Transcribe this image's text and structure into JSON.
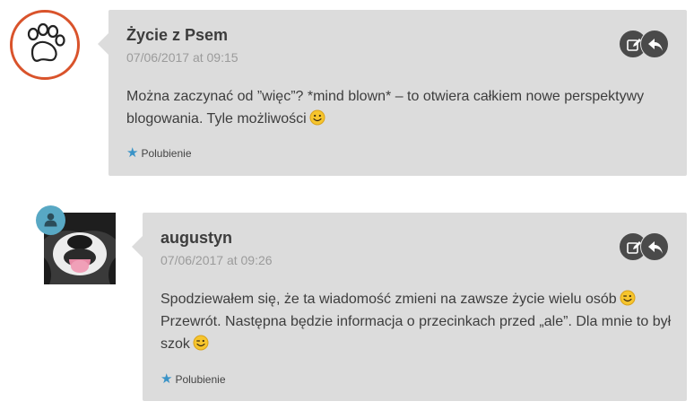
{
  "comments": [
    {
      "author": "Życie z Psem",
      "date": "07/06/2017 at 09:15",
      "text": "Można zaczynać od ”więc”? *mind blown* – to otwiera całkiem nowe perspektywy blogowania. Tyle możliwości",
      "emoji": "smile",
      "like_label": "Polubienie"
    },
    {
      "author": "augustyn",
      "date": "07/06/2017 at 09:26",
      "text_part1": "Spodziewałem się, że ta wiadomość zmieni na zawsze życie wielu osób",
      "emoji1": "wink",
      "text_part2": "Przewrót. Następna będzie informacja o przecinkach przed „ale”. Dla mnie to był szok",
      "emoji2": "wink",
      "like_label": "Polubienie"
    }
  ],
  "icons": {
    "paw_avatar": "paw-avatar",
    "user_badge": "user-icon",
    "edit": "edit-icon",
    "reply": "reply-icon",
    "star": "star-icon"
  },
  "colors": {
    "comment_bg": "#dcdcdc",
    "paw_ring": "#d9532b",
    "badge": "#58a8c4",
    "star": "#3a93c7",
    "action_bg": "#4a4a4a"
  }
}
